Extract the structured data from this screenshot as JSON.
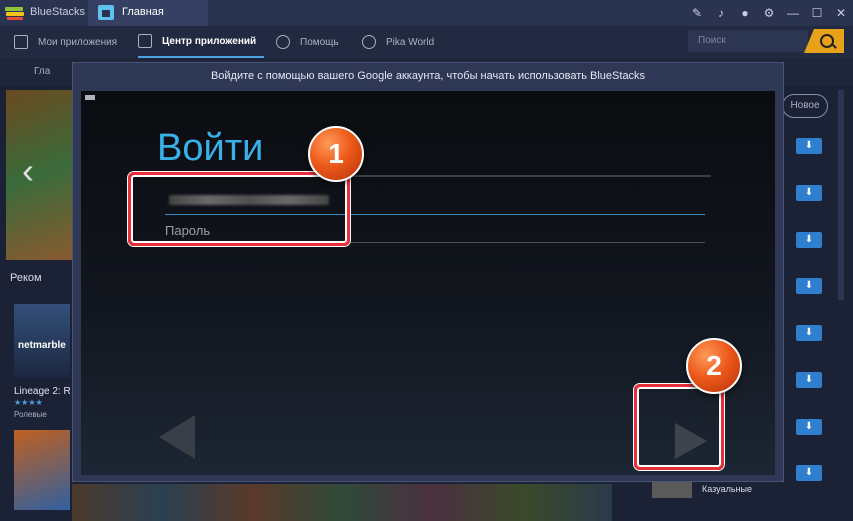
{
  "titlebar": {
    "app_name": "BlueStacks",
    "tab_label": "Главная"
  },
  "nav": {
    "items": [
      {
        "label": "Мои приложения"
      },
      {
        "label": "Центр приложений"
      },
      {
        "label": "Помощь"
      },
      {
        "label": "Pika World"
      }
    ],
    "active_index": 1,
    "search_placeholder": "Поиск"
  },
  "background": {
    "breadcrumb": "Гла",
    "section_title": "Реком",
    "app_title": "Lineage 2: R",
    "app_brand": "netmarble",
    "app_stars": "★★★★",
    "app_genre": "Ролевые",
    "new_button": "Новое",
    "casual_label": "Казуальные",
    "download_icon": "⬇"
  },
  "dialog": {
    "header": "Войдите с помощью вашего Google аккаунта, чтобы начать использовать BlueStacks",
    "signin_title": "Войти",
    "password_placeholder": "Пароль"
  },
  "annotations": {
    "marker1": "1",
    "marker2": "2",
    "color": "#e8303a"
  }
}
